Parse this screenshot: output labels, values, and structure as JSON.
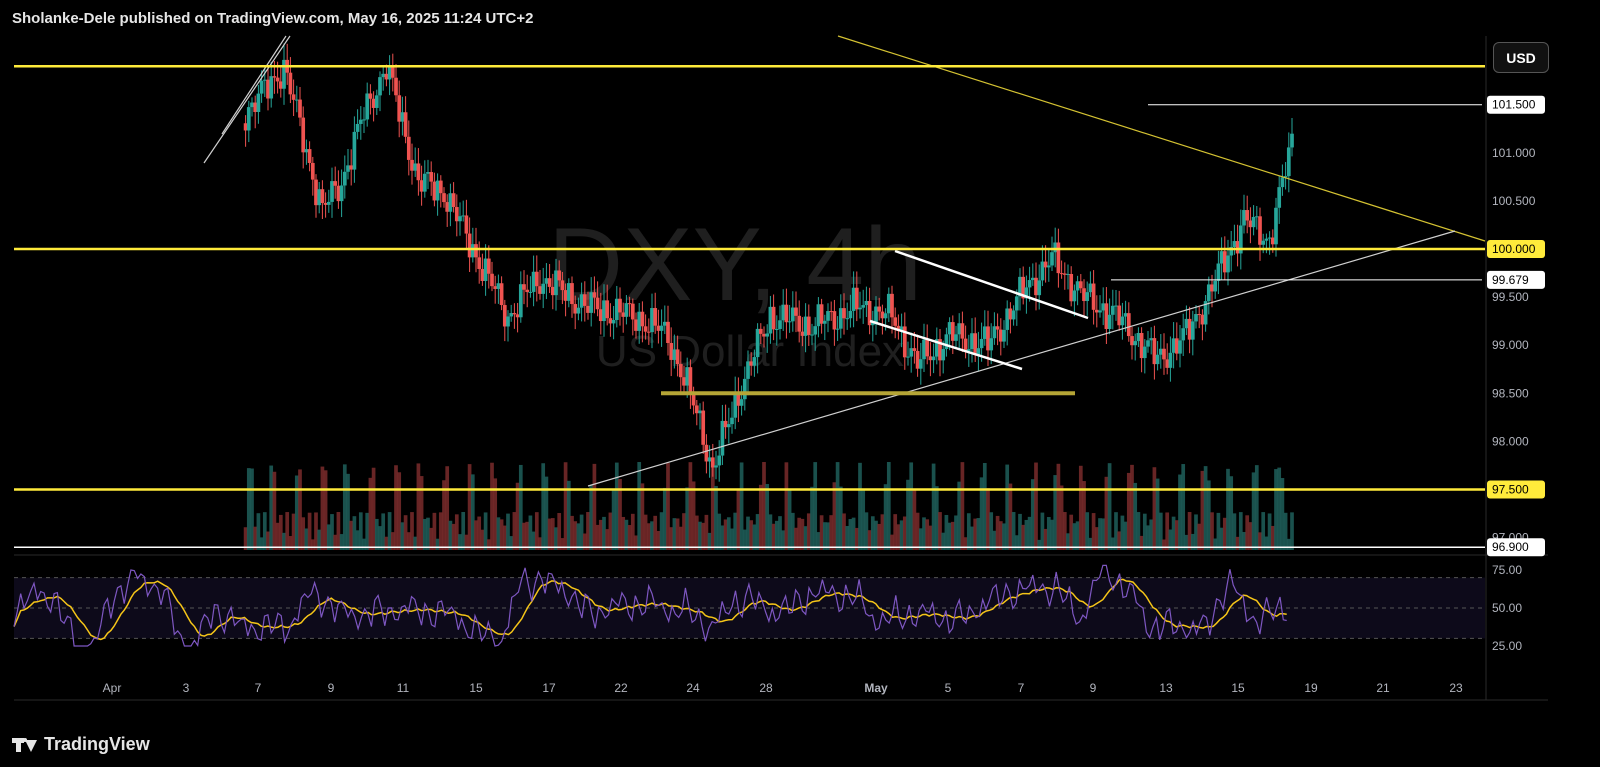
{
  "header": {
    "text": "Sholanke-Dele published on TradingView.com, May 16, 2025 11:24 UTC+2"
  },
  "currency_button": {
    "label": "USD"
  },
  "watermark": {
    "symbol": "DXY, 4h",
    "name": "US Dollar Index"
  },
  "footer": {
    "brand": "TradingView"
  },
  "colors": {
    "up": "#26a69a",
    "down": "#ef5350",
    "level": "#ffeb3b",
    "rsi": "#7e57c2",
    "rsi_ma": "#f5c518",
    "background": "#000000"
  },
  "chart_data": {
    "type": "candlestick",
    "symbol": "DXY",
    "timeframe": "4h",
    "price_scale": {
      "ticks": [
        "101.000",
        "100.500",
        "99.500",
        "99.000",
        "98.500",
        "98.000",
        "97.000"
      ],
      "range": [
        96.9,
        102.0
      ]
    },
    "price_labels": [
      "101.500",
      "100.000",
      "99.679",
      "97.500",
      "96.900"
    ],
    "horizontal_levels": [
      {
        "price": 101.9,
        "color": "#ffeb3b"
      },
      {
        "price": 100.0,
        "color": "#ffeb3b"
      },
      {
        "price": 97.5,
        "color": "#ffeb3b"
      },
      {
        "price": 96.9,
        "color": "#ffffff"
      },
      {
        "price": 98.5,
        "color": "#b5a536",
        "from_date": "Apr 23",
        "to_date": "May 8"
      },
      {
        "price": 101.5,
        "color": "#ffffff",
        "from_date": "May 12",
        "to_date": "May 23"
      },
      {
        "price": 99.679,
        "color": "#ffffff",
        "from_date": "May 10",
        "to_date": "May 23"
      }
    ],
    "x_ticks": [
      "Apr",
      "3",
      "7",
      "9",
      "11",
      "15",
      "17",
      "22",
      "24",
      "28",
      "May",
      "5",
      "7",
      "9",
      "13",
      "15",
      "19",
      "21",
      "23"
    ],
    "rsi": {
      "ticks": [
        "75.00",
        "50.00",
        "25.00"
      ],
      "upper": 70,
      "middle": 50,
      "lower": 30,
      "last": 46
    }
  }
}
